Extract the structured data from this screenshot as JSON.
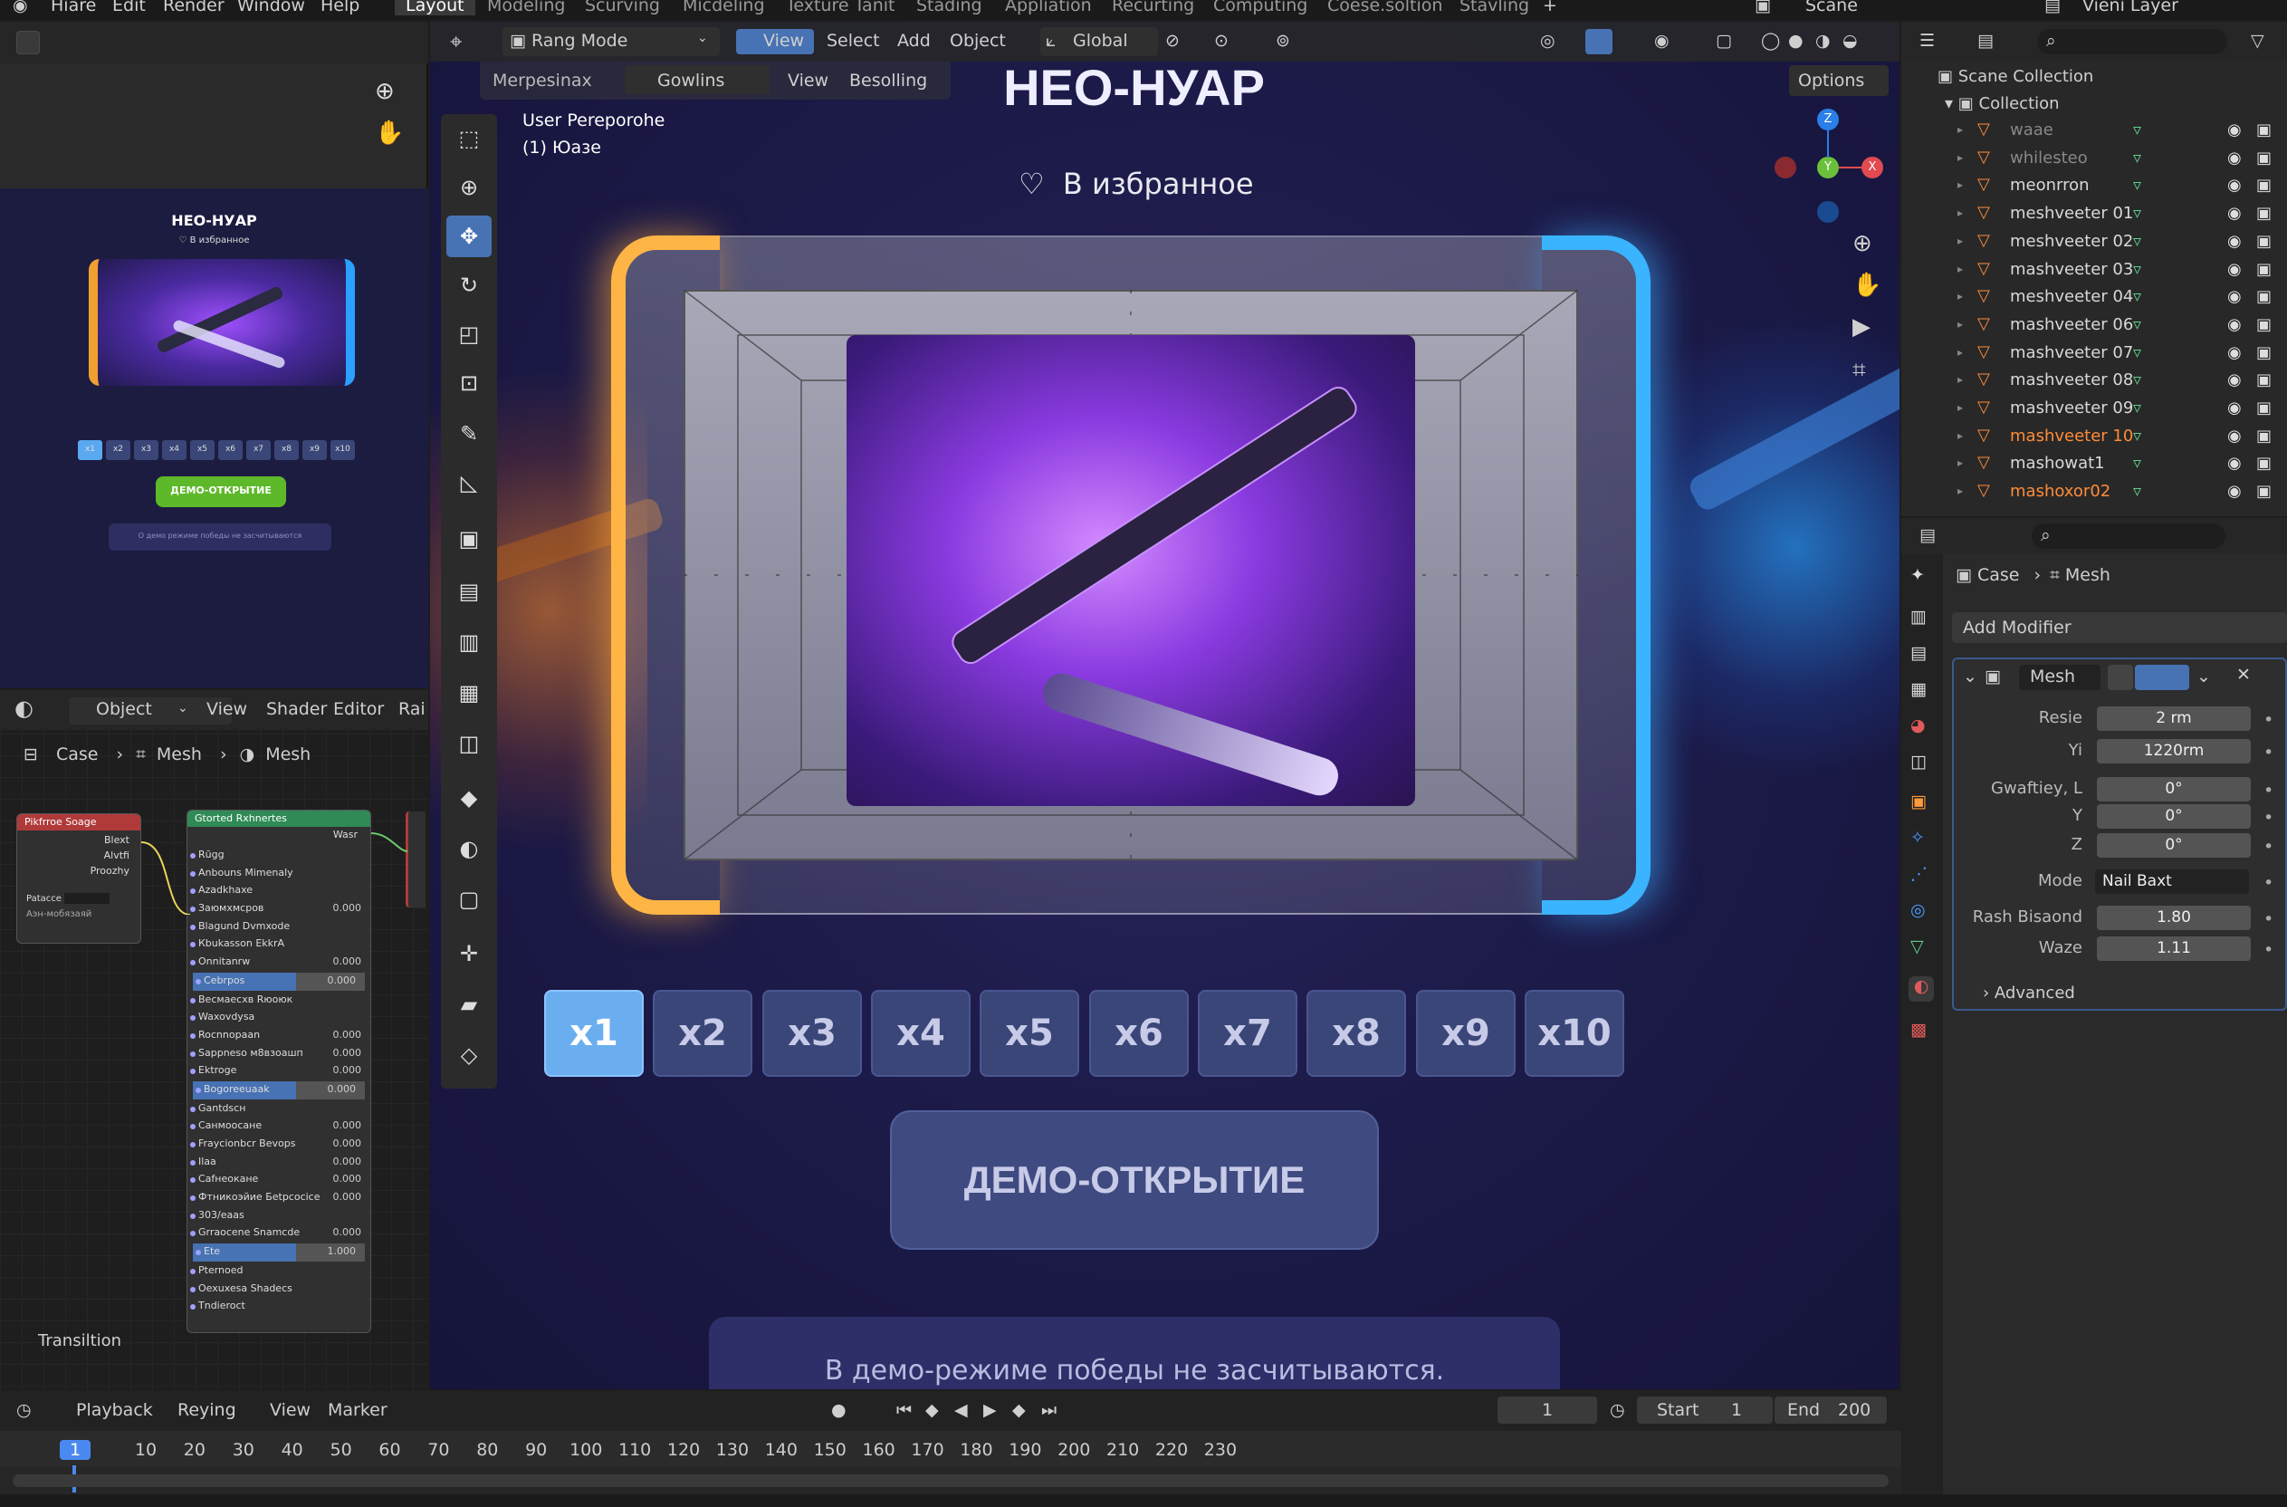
{
  "topbar": {
    "app_menu": [
      "Hiare",
      "Edit",
      "Render",
      "Window",
      "Help"
    ],
    "workspaces": [
      "Layout",
      "Modeling",
      "Scurving",
      "Micdeling",
      "Texture Tanit",
      "Stading",
      "Appliation",
      "Recurting",
      "Computing",
      "Coese.soltion",
      "Stavling"
    ],
    "scene": "Scane",
    "view_layer": "Vieni Layer"
  },
  "left_preview": {
    "title": "НЕО-НУАР",
    "fav": "♡ В избранное",
    "mults": [
      "x1",
      "x2",
      "x3",
      "x4",
      "x5",
      "x6",
      "x7",
      "x8",
      "x9",
      "x10"
    ],
    "demo": "ДЕМО-ОТКРЫТИЕ",
    "note": "О демо режиме победы не засчитываются"
  },
  "node_editor": {
    "mode": "Object",
    "menus": [
      "View",
      "Shader",
      "Editor",
      "Rai"
    ],
    "breadcrumb": [
      "Case",
      "Mesh",
      "Mesh"
    ],
    "footer_label": "Transiltion",
    "node1": {
      "title": "Pikfrroe Soage",
      "outputs": [
        "Blext",
        "Alvtfi",
        "Proozhy"
      ],
      "field": "Patacce",
      "check": "Аэн-мобязаяй"
    },
    "node2": {
      "title": "Gtorted Rxhnertes",
      "out": "Wasr",
      "rows": [
        [
          "Rūgg",
          ""
        ],
        [
          "Anbouns Mimenaly",
          ""
        ],
        [
          "Azadkhaxe",
          ""
        ],
        [
          "Заюмхмсров",
          "0.000"
        ],
        [
          "Вlagund Dvmxode",
          ""
        ],
        [
          "Кbukasson EkkrA",
          ""
        ],
        [
          "Onnitanrw",
          "0.000"
        ],
        [
          "Cebrpos",
          "0.000"
        ],
        [
          "Весмаесхв Rюоюк",
          ""
        ],
        [
          "Waxovdysa",
          ""
        ],
        [
          "Rocnnopaan",
          "0.000"
        ],
        [
          "Sappneso м8взоашп",
          "0.000"
        ],
        [
          "Ektroge",
          "0.000"
        ],
        [
          "Bogoreeuaak",
          "0.000"
        ],
        [
          "Gantdscн",
          ""
        ],
        [
          "Caнмоосане",
          "0.000"
        ],
        [
          "Fraycionbcr Bevops",
          "0.000"
        ],
        [
          "Ilaa",
          "0.000"
        ],
        [
          "Cafнеоканe",
          "0.000"
        ],
        [
          "Фтникоэйие Беtpcocice",
          "0.000"
        ],
        [
          "303/eaas",
          ""
        ],
        [
          "Grraocene Snamcde",
          "0.000"
        ],
        [
          "Ete",
          "1.000"
        ],
        [
          "Pternoed",
          ""
        ],
        [
          "Оexuxesa Shadecs",
          ""
        ],
        [
          "Tndieroct",
          ""
        ]
      ]
    }
  },
  "viewport": {
    "mode": "Rang Mode",
    "menus": [
      "View",
      "Select",
      "Add",
      "Object"
    ],
    "orientation": "Global",
    "sub_menus": [
      "Merpesinax",
      "Gowlins",
      "View",
      "Besolling"
    ],
    "options": "Options",
    "info_line1": "User Pereporohe",
    "info_line2": "(1) Юaзe"
  },
  "game": {
    "title": "НЕО-НУАР",
    "fav": "В избранное",
    "multipliers": [
      "x1",
      "x2",
      "x3",
      "x4",
      "x5",
      "x6",
      "x7",
      "x8",
      "x9",
      "x10"
    ],
    "active_index": 0,
    "demo_button": "ДЕМО-ОТКРЫТИЕ",
    "note": "В демо-режиме победы не засчитываются."
  },
  "outliner": {
    "root": "Scane Collection",
    "collection": "Collection",
    "items": [
      {
        "name": "waae",
        "color": "dim"
      },
      {
        "name": "whilesteo",
        "color": "dim"
      },
      {
        "name": "meonrron",
        "color": "normal"
      },
      {
        "name": "meshveeter 01",
        "color": "normal"
      },
      {
        "name": "meshveeter 02",
        "color": "normal"
      },
      {
        "name": "mashveeter 03",
        "color": "normal"
      },
      {
        "name": "meshveeter 04",
        "color": "normal"
      },
      {
        "name": "mashveeter 06",
        "color": "normal"
      },
      {
        "name": "mashveeter 07",
        "color": "normal"
      },
      {
        "name": "mashveeter 08",
        "color": "normal"
      },
      {
        "name": "mashveeter 09",
        "color": "normal"
      },
      {
        "name": "mashveeter 10",
        "color": "orange"
      },
      {
        "name": "mashowat1",
        "color": "normal"
      },
      {
        "name": "mashoxor02",
        "color": "orange"
      }
    ]
  },
  "properties": {
    "breadcrumb": [
      "Case",
      "Mesh"
    ],
    "add_modifier": "Add Modifier",
    "modifier_name": "Mesh",
    "fields": [
      {
        "label": "Resie",
        "value": "2 rm"
      },
      {
        "label": "Yi",
        "value": "1220rm"
      },
      {
        "label": "Gwaftiey, L",
        "value": "0°"
      },
      {
        "label": "Y",
        "value": "0°"
      },
      {
        "label": "Z",
        "value": "0°"
      },
      {
        "label": "Mode",
        "value": "Nail Baxt"
      },
      {
        "label": "Rash Bisaond",
        "value": "1.80"
      },
      {
        "label": "Waze",
        "value": "1.11"
      }
    ],
    "advanced": "Advanced"
  },
  "timeline": {
    "menus": [
      "Playback",
      "Reying",
      "View",
      "Marker"
    ],
    "current": "1",
    "start_label": "Start",
    "start": "1",
    "end_label": "End",
    "end": "200",
    "ticks": [
      "1",
      "10",
      "20",
      "30",
      "40",
      "50",
      "60",
      "70",
      "80",
      "90",
      "100",
      "110",
      "120",
      "130",
      "140",
      "150",
      "160",
      "170",
      "180",
      "190",
      "200",
      "210",
      "220",
      "230"
    ]
  }
}
